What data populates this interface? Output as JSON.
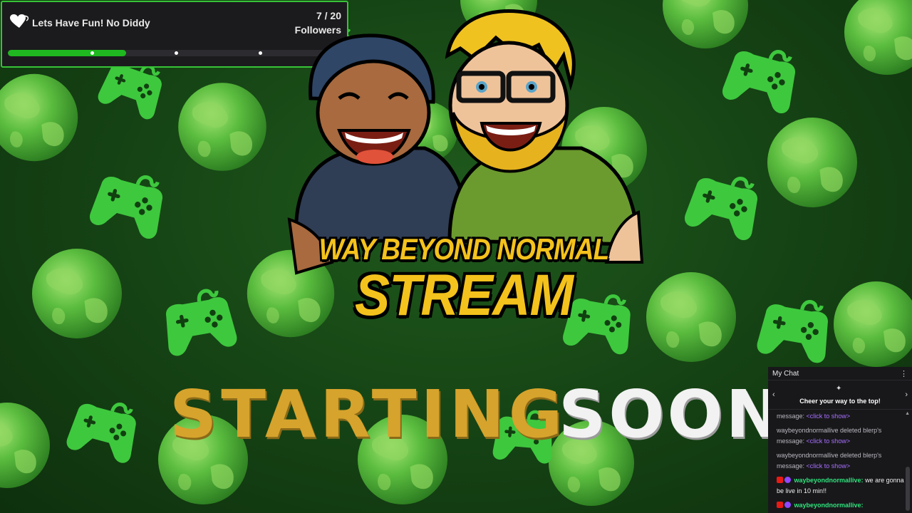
{
  "goal": {
    "title": "Lets Have Fun! No Diddy",
    "count": "7 / 20",
    "unit": "Followers",
    "progress": 0.35,
    "colors": {
      "bar": "#20b820",
      "border": "#37c337"
    }
  },
  "logo": {
    "line1": "WAY BEYOND NORMAL",
    "line2": "STREAM"
  },
  "headline": {
    "word1": "STARTING",
    "word2": "SOON"
  },
  "chat": {
    "title": "My Chat",
    "cheer_text": "Cheer your way to the top!",
    "messages": [
      {
        "prefix": "message:",
        "link": "<click to show>"
      },
      {
        "text": "waybeyondnormallive deleted blerp's message:",
        "link": "<click to show>"
      },
      {
        "text": "waybeyondnormallive deleted blerp's message:",
        "link": "<click to show>"
      },
      {
        "user": "waybeyondnormallive:",
        "body": "we are gonna be live in 10 min!!"
      },
      {
        "user": "waybeyondnormallive:",
        "body": ""
      }
    ]
  },
  "icons": [
    "heart-icon",
    "chevron-left-icon",
    "chevron-right-icon",
    "kebab-menu-icon",
    "bits-icon",
    "moderator-badge-icon",
    "prime-badge-icon",
    "globe-icon",
    "gamepad-icon"
  ],
  "colors": {
    "background": "#154214",
    "globe": "#4caf3a",
    "gamepad": "#3ec83e",
    "starting": "#d6a32c",
    "soon": "#f2f2f2"
  }
}
